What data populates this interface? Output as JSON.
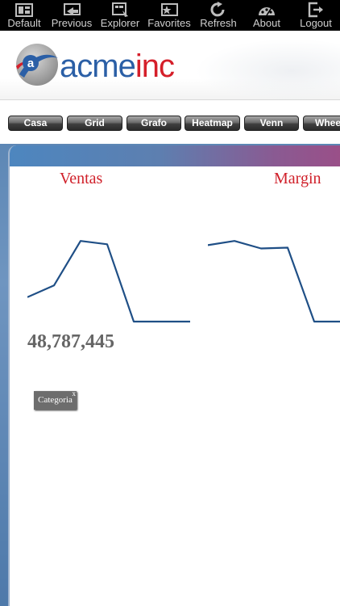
{
  "toolbar": {
    "items": [
      {
        "label": "Default",
        "icon": "dashboard-icon"
      },
      {
        "label": "Previous",
        "icon": "previous-icon"
      },
      {
        "label": "Explorer",
        "icon": "explorer-icon"
      },
      {
        "label": "Favorites",
        "icon": "favorites-icon"
      },
      {
        "label": "Refresh",
        "icon": "refresh-icon"
      },
      {
        "label": "About",
        "icon": "about-icon"
      },
      {
        "label": "Logout",
        "icon": "logout-icon"
      }
    ]
  },
  "brand": {
    "acme": "acme",
    "inc": "inc",
    "logo_letter": "a",
    "colors": {
      "blue": "#2b5fa6",
      "red": "#d51f2a"
    }
  },
  "tabs": [
    "Casa",
    "Grid",
    "Grafo",
    "Heatmap",
    "Venn",
    "Wheel"
  ],
  "dashboard": {
    "kpis": [
      {
        "title": "Ventas",
        "value": "48,787,445",
        "trend": [
          0.29,
          0.43,
          0.96,
          0.92,
          0.0,
          0.0
        ]
      },
      {
        "title": "Margin",
        "value": "",
        "trend": [
          0.91,
          0.96,
          0.87,
          0.88,
          0.0,
          0.0
        ]
      }
    ],
    "filter": {
      "label": "Categoria",
      "corner": "x"
    }
  }
}
